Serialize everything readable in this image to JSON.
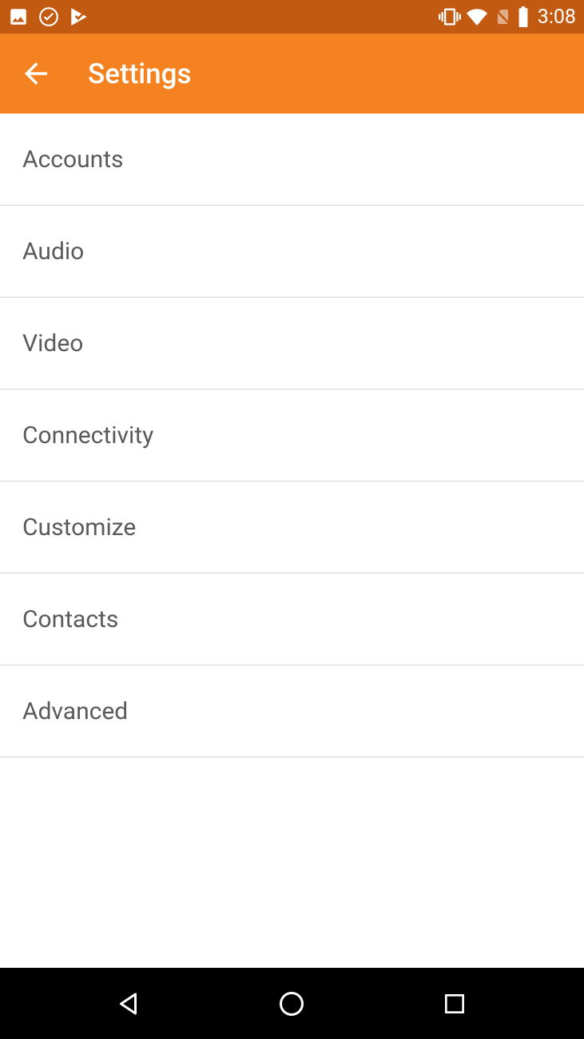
{
  "status": {
    "clock": "3:08"
  },
  "header": {
    "title": "Settings"
  },
  "list": {
    "items": [
      {
        "label": "Accounts"
      },
      {
        "label": "Audio"
      },
      {
        "label": "Video"
      },
      {
        "label": "Connectivity"
      },
      {
        "label": "Customize"
      },
      {
        "label": "Contacts"
      },
      {
        "label": "Advanced"
      }
    ]
  }
}
